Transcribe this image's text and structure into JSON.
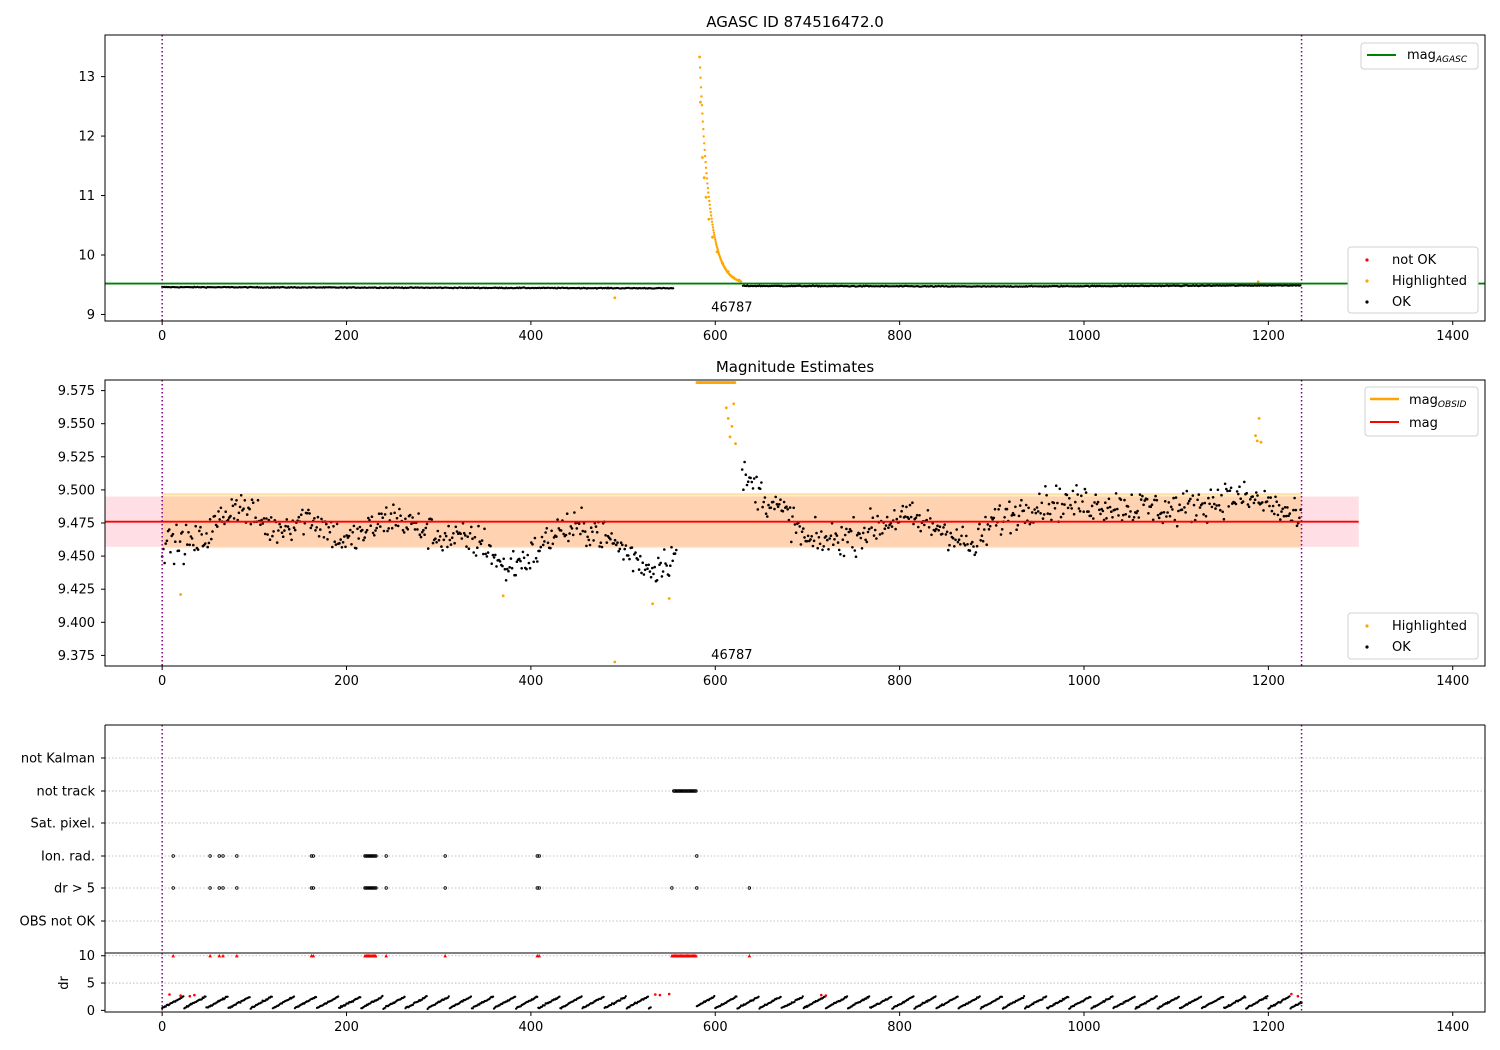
{
  "chart_data": [
    {
      "type": "scatter",
      "title": "AGASC ID 874516472.0",
      "xlabel": "",
      "ylabel": "",
      "xlim": [
        -62,
        1435
      ],
      "ylim": [
        8.89,
        13.7
      ],
      "xticks": [
        0,
        200,
        400,
        600,
        800,
        1000,
        1200,
        1400
      ],
      "yticks": [
        9,
        10,
        11,
        12,
        13
      ],
      "obsid_label": {
        "text": "46787",
        "x": 618,
        "y": 9.05
      },
      "vlines": [
        0,
        1236
      ],
      "hlines": [
        {
          "name": "mag_AGASC",
          "y": 9.52,
          "color": "#008000"
        }
      ],
      "series": [
        {
          "name": "OK",
          "color": "#000000",
          "baseline": [
            [
              0,
              9.46
            ],
            [
              560,
              9.44
            ],
            [
              630,
              9.48
            ],
            [
              900,
              9.47
            ],
            [
              1236,
              9.49
            ]
          ]
        },
        {
          "name": "Highlighted",
          "color": "#ffa500",
          "points": [
            [
              583,
              13.33
            ],
            [
              584,
              12.57
            ],
            [
              586,
              11.64
            ],
            [
              588,
              11.3
            ],
            [
              590,
              10.97
            ],
            [
              593,
              10.6
            ],
            [
              597,
              10.3
            ],
            [
              602,
              10.05
            ],
            [
              608,
              9.86
            ],
            [
              614,
              9.72
            ],
            [
              620,
              9.62
            ],
            [
              626,
              9.58
            ],
            [
              491,
              9.28
            ],
            [
              1189,
              9.55
            ]
          ]
        },
        {
          "name": "not OK",
          "color": "#ff0000",
          "points": []
        }
      ],
      "legends": {
        "upper_right": [
          "mag_AGASC"
        ],
        "lower_right": [
          "not OK",
          "Highlighted",
          "OK"
        ]
      }
    },
    {
      "type": "scatter",
      "title": "Magnitude Estimates",
      "xlabel": "",
      "ylabel": "",
      "xlim": [
        -62,
        1435
      ],
      "ylim": [
        9.367,
        9.583
      ],
      "xticks": [
        0,
        200,
        400,
        600,
        800,
        1000,
        1200,
        1400
      ],
      "yticks": [
        9.375,
        9.4,
        9.425,
        9.45,
        9.475,
        9.5,
        9.525,
        9.55,
        9.575
      ],
      "yticklabels": [
        "9.375",
        "9.400",
        "9.425",
        "9.450",
        "9.475",
        "9.500",
        "9.525",
        "9.550",
        "9.575"
      ],
      "obsid_label": {
        "text": "46787",
        "x": 618,
        "y": 9.373
      },
      "vlines": [
        0,
        1236
      ],
      "mean_line": {
        "name": "mag",
        "y": 9.476,
        "color": "#ff0000",
        "x_range": [
          -62,
          1298
        ]
      },
      "band_outer": {
        "y_range": [
          9.457,
          9.495
        ],
        "x_range": [
          -62,
          1298
        ],
        "color": "#ffc0cb"
      },
      "band_inner": {
        "y_range": [
          9.456,
          9.497
        ],
        "x_range": [
          0,
          1236
        ],
        "color": "#ffa500"
      },
      "ok_trend": [
        [
          0,
          9.46
        ],
        [
          40,
          9.46
        ],
        [
          80,
          9.49
        ],
        [
          120,
          9.47
        ],
        [
          160,
          9.48
        ],
        [
          200,
          9.46
        ],
        [
          250,
          9.48
        ],
        [
          300,
          9.465
        ],
        [
          350,
          9.46
        ],
        [
          370,
          9.44
        ],
        [
          400,
          9.45
        ],
        [
          430,
          9.47
        ],
        [
          470,
          9.47
        ],
        [
          500,
          9.455
        ],
        [
          530,
          9.44
        ],
        [
          555,
          9.45
        ],
        [
          630,
          9.51
        ],
        [
          660,
          9.49
        ],
        [
          680,
          9.48
        ],
        [
          700,
          9.46
        ],
        [
          750,
          9.465
        ],
        [
          800,
          9.48
        ],
        [
          850,
          9.47
        ],
        [
          880,
          9.455
        ],
        [
          900,
          9.475
        ],
        [
          950,
          9.49
        ],
        [
          1000,
          9.49
        ],
        [
          1100,
          9.485
        ],
        [
          1160,
          9.495
        ],
        [
          1200,
          9.49
        ],
        [
          1236,
          9.475
        ]
      ],
      "highlighted_points": [
        [
          20,
          9.421
        ],
        [
          370,
          9.42
        ],
        [
          532,
          9.414
        ],
        [
          550,
          9.418
        ],
        [
          491,
          9.37
        ],
        [
          612,
          9.562
        ],
        [
          614,
          9.554
        ],
        [
          618,
          9.548
        ],
        [
          620,
          9.565
        ],
        [
          616,
          9.54
        ],
        [
          622,
          9.535
        ],
        [
          1186,
          9.541
        ],
        [
          1188,
          9.537
        ],
        [
          1190,
          9.554
        ],
        [
          1192,
          9.536
        ]
      ],
      "highlighted_clip": {
        "x_range": [
          580,
          622
        ],
        "y": 9.581
      },
      "series": [
        {
          "name": "mag_OBSID",
          "color": "#ffa500"
        },
        {
          "name": "mag",
          "color": "#ff0000"
        },
        {
          "name": "Highlighted",
          "color": "#ffa500"
        },
        {
          "name": "OK",
          "color": "#000000"
        }
      ],
      "legends": {
        "upper_right": [
          "mag_OBSID",
          "mag"
        ],
        "lower_right": [
          "Highlighted",
          "OK"
        ]
      }
    },
    {
      "type": "scatter",
      "title": "",
      "xlabel": "",
      "ylabel": "",
      "xlim": [
        -62,
        1435
      ],
      "xticks": [
        0,
        200,
        400,
        600,
        800,
        1000,
        1200,
        1400
      ],
      "vlines": [
        0,
        1236
      ],
      "flag_rows": [
        "not Kalman",
        "not track",
        "Sat. pixel.",
        "Ion. rad.",
        "dr > 5",
        "OBS not OK"
      ],
      "flags": {
        "not track": [
          [
            555,
            580
          ]
        ],
        "Ion. rad.": [
          [
            12,
            12
          ],
          [
            52,
            52
          ],
          [
            62,
            62
          ],
          [
            66,
            66
          ],
          [
            81,
            81
          ],
          [
            162,
            164
          ],
          [
            220,
            232
          ],
          [
            243,
            243
          ],
          [
            307,
            307
          ],
          [
            407,
            409
          ],
          [
            580,
            580
          ]
        ],
        "dr > 5": [
          [
            12,
            12
          ],
          [
            52,
            52
          ],
          [
            62,
            62
          ],
          [
            66,
            66
          ],
          [
            81,
            81
          ],
          [
            162,
            164
          ],
          [
            220,
            232
          ],
          [
            243,
            243
          ],
          [
            307,
            307
          ],
          [
            407,
            409
          ],
          [
            553,
            553
          ],
          [
            580,
            580
          ],
          [
            637,
            637
          ]
        ]
      }
    },
    {
      "type": "scatter",
      "title": "",
      "xlabel": "",
      "ylabel": "dr",
      "xlim": [
        -62,
        1435
      ],
      "ylim": [
        -0.3,
        10.5
      ],
      "yticks": [
        0,
        5,
        10
      ],
      "xticks": [
        0,
        200,
        400,
        600,
        800,
        1000,
        1200,
        1400
      ],
      "vlines": [
        0,
        1236
      ],
      "red_markers_at_10": [
        [
          12,
          12
        ],
        [
          52,
          52
        ],
        [
          62,
          62
        ],
        [
          66,
          66
        ],
        [
          81,
          81
        ],
        [
          162,
          164
        ],
        [
          220,
          232
        ],
        [
          243,
          243
        ],
        [
          307,
          307
        ],
        [
          407,
          409
        ],
        [
          553,
          580
        ],
        [
          637,
          637
        ]
      ],
      "red_points_low": [
        [
          8,
          2.9
        ],
        [
          20,
          2.7
        ],
        [
          30,
          2.6
        ],
        [
          35,
          2.8
        ],
        [
          535,
          2.9
        ],
        [
          540,
          2.8
        ],
        [
          550,
          3.0
        ],
        [
          715,
          2.8
        ],
        [
          720,
          2.7
        ],
        [
          1225,
          3.0
        ],
        [
          1232,
          2.6
        ]
      ]
    }
  ]
}
